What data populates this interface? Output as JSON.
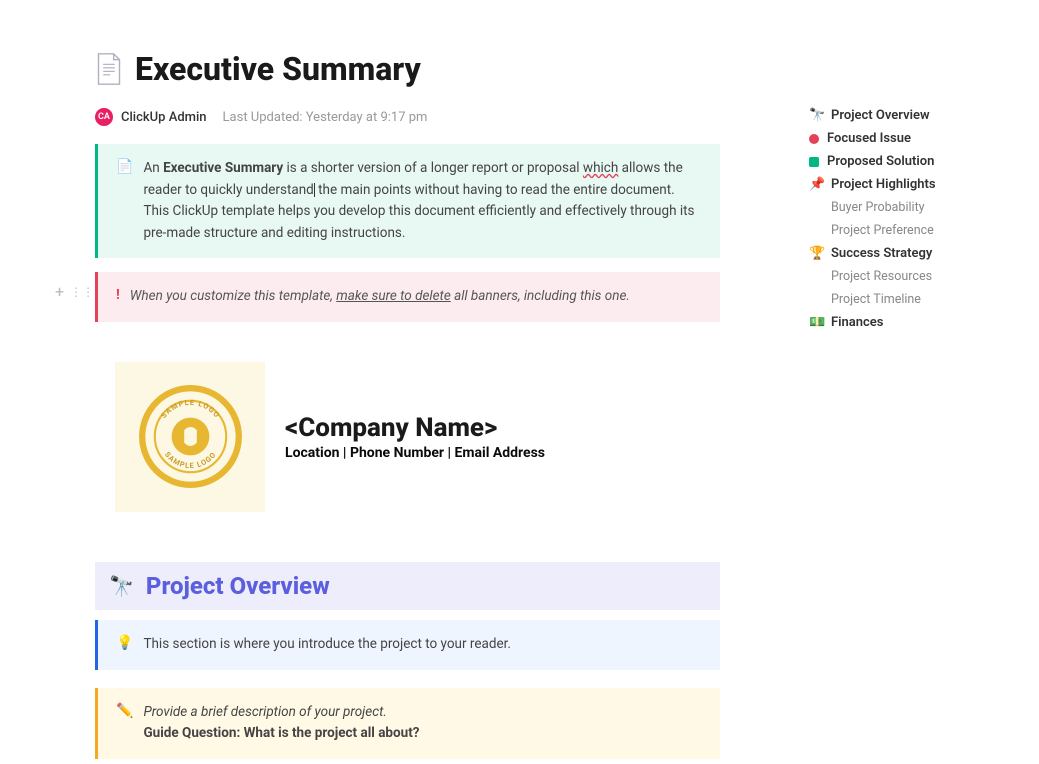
{
  "title": "Executive Summary",
  "author": {
    "initials": "CA",
    "name": "ClickUp Admin",
    "lastUpdated": "Last Updated: Yesterday at 9:17 pm"
  },
  "banners": {
    "intro": {
      "prefix": "An ",
      "bold": "Executive Summary",
      "text1": " is a shorter version of a longer report or proposal ",
      "underlined": "which",
      "text2": " allows the reader to quickly understand",
      "text3": " the main points without having to read the entire document. This ClickUp template helps you develop this document efficiently and effectively through its pre-made structure and editing instructions."
    },
    "warning": {
      "text1": "When you customize this template, ",
      "underlined": "make sure to delete",
      "text2": " all banners, including this one."
    },
    "overviewIntro": "This section is where you introduce the project to your reader.",
    "guide": {
      "text": "Provide a brief description of your project.",
      "question": "Guide Question: What is the project all about?"
    }
  },
  "company": {
    "name": "<Company Name>",
    "meta": "Location | Phone Number | Email Address",
    "logoText1": "SAMPLE LOGO",
    "logoText2": "SAMPLE LOGO"
  },
  "sections": {
    "overview": {
      "icon": "🔭",
      "title": "Project Overview"
    }
  },
  "outline": [
    {
      "type": "emoji",
      "icon": "🔭",
      "label": "Project Overview"
    },
    {
      "type": "dot",
      "color": "#e44258",
      "label": "Focused Issue"
    },
    {
      "type": "dot",
      "color": "#00b884",
      "label": "Proposed Solution"
    },
    {
      "type": "emoji",
      "icon": "📌",
      "label": "Project Highlights"
    },
    {
      "type": "sub",
      "label": "Buyer Probability"
    },
    {
      "type": "sub",
      "label": "Project Preference"
    },
    {
      "type": "emoji",
      "icon": "🏆",
      "label": "Success Strategy"
    },
    {
      "type": "sub",
      "label": "Project Resources"
    },
    {
      "type": "sub",
      "label": "Project Timeline"
    },
    {
      "type": "emoji",
      "icon": "💵",
      "label": "Finances"
    }
  ]
}
